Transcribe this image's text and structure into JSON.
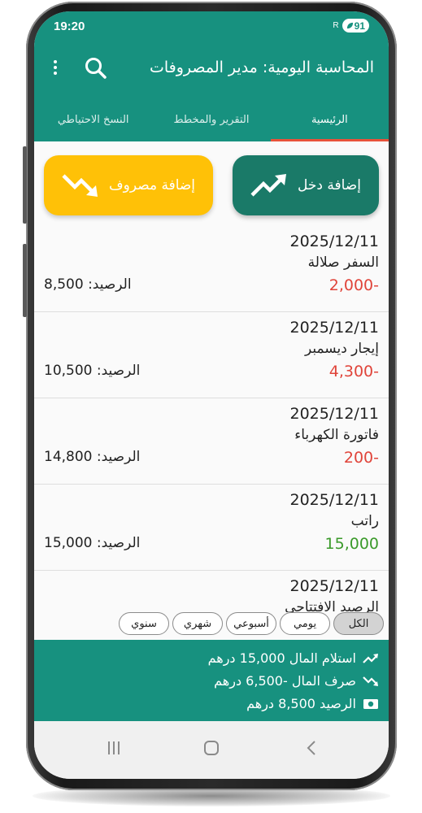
{
  "status_bar": {
    "time": "19:20",
    "signal": "R",
    "battery": "91"
  },
  "app_bar": {
    "title": "المحاسبة اليومية: مدير المصروفات",
    "menu_icon": "more-vert-icon",
    "search_icon": "search-icon"
  },
  "tabs": [
    {
      "label": "الرئيسية",
      "active": true
    },
    {
      "label": "التقرير والمخطط",
      "active": false
    },
    {
      "label": "النسخ الاحتياطي",
      "active": false
    }
  ],
  "actions": {
    "add_income": {
      "label": "إضافة دخل",
      "icon": "trending-up-icon",
      "color": "#1a7a68"
    },
    "add_expense": {
      "label": "إضافة مصروف",
      "icon": "trending-down-icon",
      "color": "#ffc107"
    }
  },
  "transactions": [
    {
      "date": "2025/12/11",
      "description": "السفر صلالة",
      "amount": "2,000-",
      "type": "expense",
      "balance": "الرصيد: 8,500"
    },
    {
      "date": "2025/12/11",
      "description": "إيجار ديسمبر",
      "amount": "4,300-",
      "type": "expense",
      "balance": "الرصيد: 10,500"
    },
    {
      "date": "2025/12/11",
      "description": "فاتورة الكهرباء",
      "amount": "200-",
      "type": "expense",
      "balance": "الرصيد: 14,800"
    },
    {
      "date": "2025/12/11",
      "description": "راتب",
      "amount": "15,000",
      "type": "income",
      "balance": "الرصيد: 15,000"
    },
    {
      "date": "2025/12/11",
      "description": "الرصيد الافتتاحي",
      "amount": "",
      "type": "income",
      "balance": ""
    }
  ],
  "filters": [
    {
      "label": "الكل",
      "selected": true
    },
    {
      "label": "يومي",
      "selected": false
    },
    {
      "label": "أسبوعي",
      "selected": false
    },
    {
      "label": "شهري",
      "selected": false
    },
    {
      "label": "سنوي",
      "selected": false
    }
  ],
  "summary": {
    "received": "استلام المال 15,000 درهم",
    "spent": "صرف المال -6,500 درهم",
    "balance": "الرصيد 8,500 درهم"
  },
  "colors": {
    "primary": "#17917f",
    "tab_indicator": "#e8523a",
    "expense_amount": "#e0443a",
    "income_amount": "#3a9a2a"
  },
  "nav_bar": {
    "recent_icon": "recent-apps-icon",
    "home_icon": "home-icon",
    "back_icon": "back-icon"
  }
}
